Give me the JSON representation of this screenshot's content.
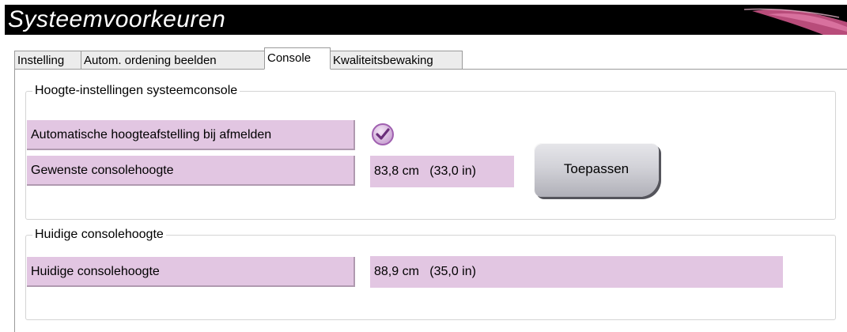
{
  "window": {
    "title": "Systeemvoorkeuren"
  },
  "tabs": [
    {
      "label": "Instelling",
      "active": false
    },
    {
      "label": "Autom. ordening beelden",
      "active": false
    },
    {
      "label": "Console",
      "active": true
    },
    {
      "label": "Kwaliteitsbewaking",
      "active": false
    }
  ],
  "height_settings": {
    "title": "Hoogte-instellingen systeemconsole",
    "auto_adjust_label": "Automatische hoogteafstelling bij afmelden",
    "auto_adjust_checked": true,
    "desired_height_label": "Gewenste consolehoogte",
    "desired_height_value": "83,8 cm   (33,0 in)",
    "apply_label": "Toepassen"
  },
  "current_height": {
    "title": "Huidige consolehoogte",
    "label": "Huidige consolehoogte",
    "value": "88,9 cm   (35,0 in)"
  },
  "colors": {
    "field_bg": "#e2c6e2",
    "accent": "#a060b0"
  },
  "icons": {
    "check": "check-circle-icon"
  }
}
